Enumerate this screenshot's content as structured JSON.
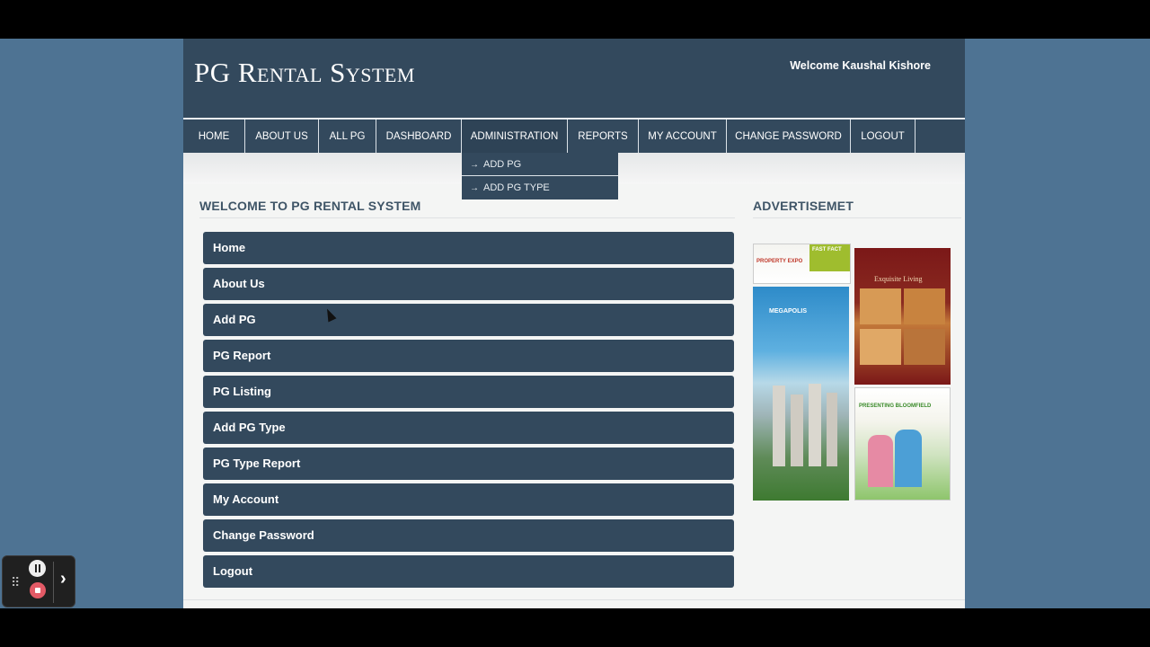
{
  "header": {
    "logo": "PG Rental System",
    "welcome": "Welcome Kaushal Kishore"
  },
  "nav": {
    "items": [
      "HOME",
      "ABOUT US",
      "ALL PG",
      "DASHBOARD",
      "ADMINISTRATION",
      "REPORTS",
      "MY ACCOUNT",
      "CHANGE PASSWORD",
      "LOGOUT"
    ],
    "active": "ADMINISTRATION"
  },
  "dropdown": {
    "arrow": "→",
    "items": [
      "ADD PG",
      "ADD PG TYPE"
    ]
  },
  "main": {
    "title": "WELCOME TO PG RENTAL SYSTEM",
    "menu": [
      "Home",
      "About Us",
      "Add PG",
      "PG Report",
      "PG Listing",
      "Add PG Type",
      "PG Type Report",
      "My Account",
      "Change Password",
      "Logout"
    ]
  },
  "sidebar": {
    "title": "ADVERTISEMET",
    "ads": [
      {
        "text": "PROPERTY EXPO",
        "badge": "FAST FACT"
      },
      {
        "text": "Exquisite Living"
      },
      {
        "text": "MEGAPOLIS"
      },
      {
        "text": "PRESENTING BLOOMFIELD"
      }
    ]
  },
  "recorder": {
    "icons": [
      "grip-icon",
      "pause-icon",
      "stop-icon",
      "chevron-right-icon"
    ]
  }
}
